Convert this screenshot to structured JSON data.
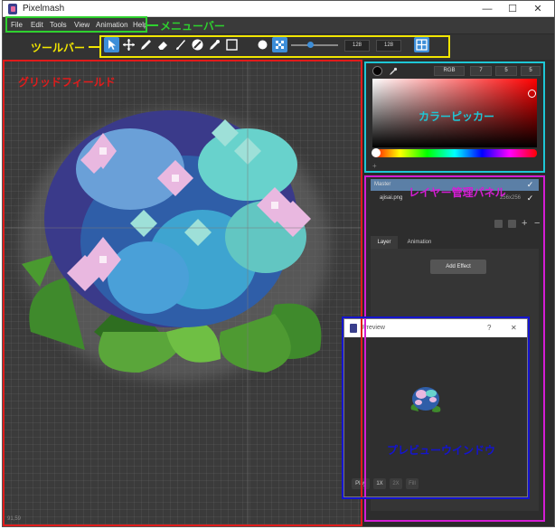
{
  "window": {
    "title": "Pixelmash",
    "minimize": "—",
    "maximize": "☐",
    "close": "✕"
  },
  "menu": {
    "items": [
      "File",
      "Edit",
      "Tools",
      "View",
      "Animation",
      "Help"
    ]
  },
  "toolbar": {
    "width_value": "128",
    "height_value": "128"
  },
  "grid": {
    "coord": "91,59"
  },
  "picker": {
    "mode": "RGB",
    "r": "7",
    "g": "5",
    "b": "5"
  },
  "layers": {
    "master_label": "Master",
    "layer1_name": "ajisai.png",
    "layer1_size": "256x256",
    "tab_layer": "Layer",
    "tab_animation": "Animation",
    "add_effect": "Add Effect"
  },
  "preview": {
    "title": "Preview",
    "help": "?",
    "close": "✕",
    "play": "Play",
    "zoom1": "1X",
    "zoom2": "2X",
    "fill": "Fill"
  },
  "annotations": {
    "menubar": "メニューバー",
    "toolbar": "ツールバー",
    "grid": "グリッドフィールド",
    "picker": "カラーピッカー",
    "layer_panel": "レイヤー管理パネル",
    "preview": "プレビューウインドウ"
  },
  "colors": {
    "menubar_box": "#2ed12e",
    "toolbar_box": "#f2e600",
    "grid_box": "#e11b1b",
    "picker_box": "#1ec7d6",
    "layer_box": "#d41dd4",
    "preview_box": "#1414d0",
    "accent": "#3d8ed8"
  }
}
